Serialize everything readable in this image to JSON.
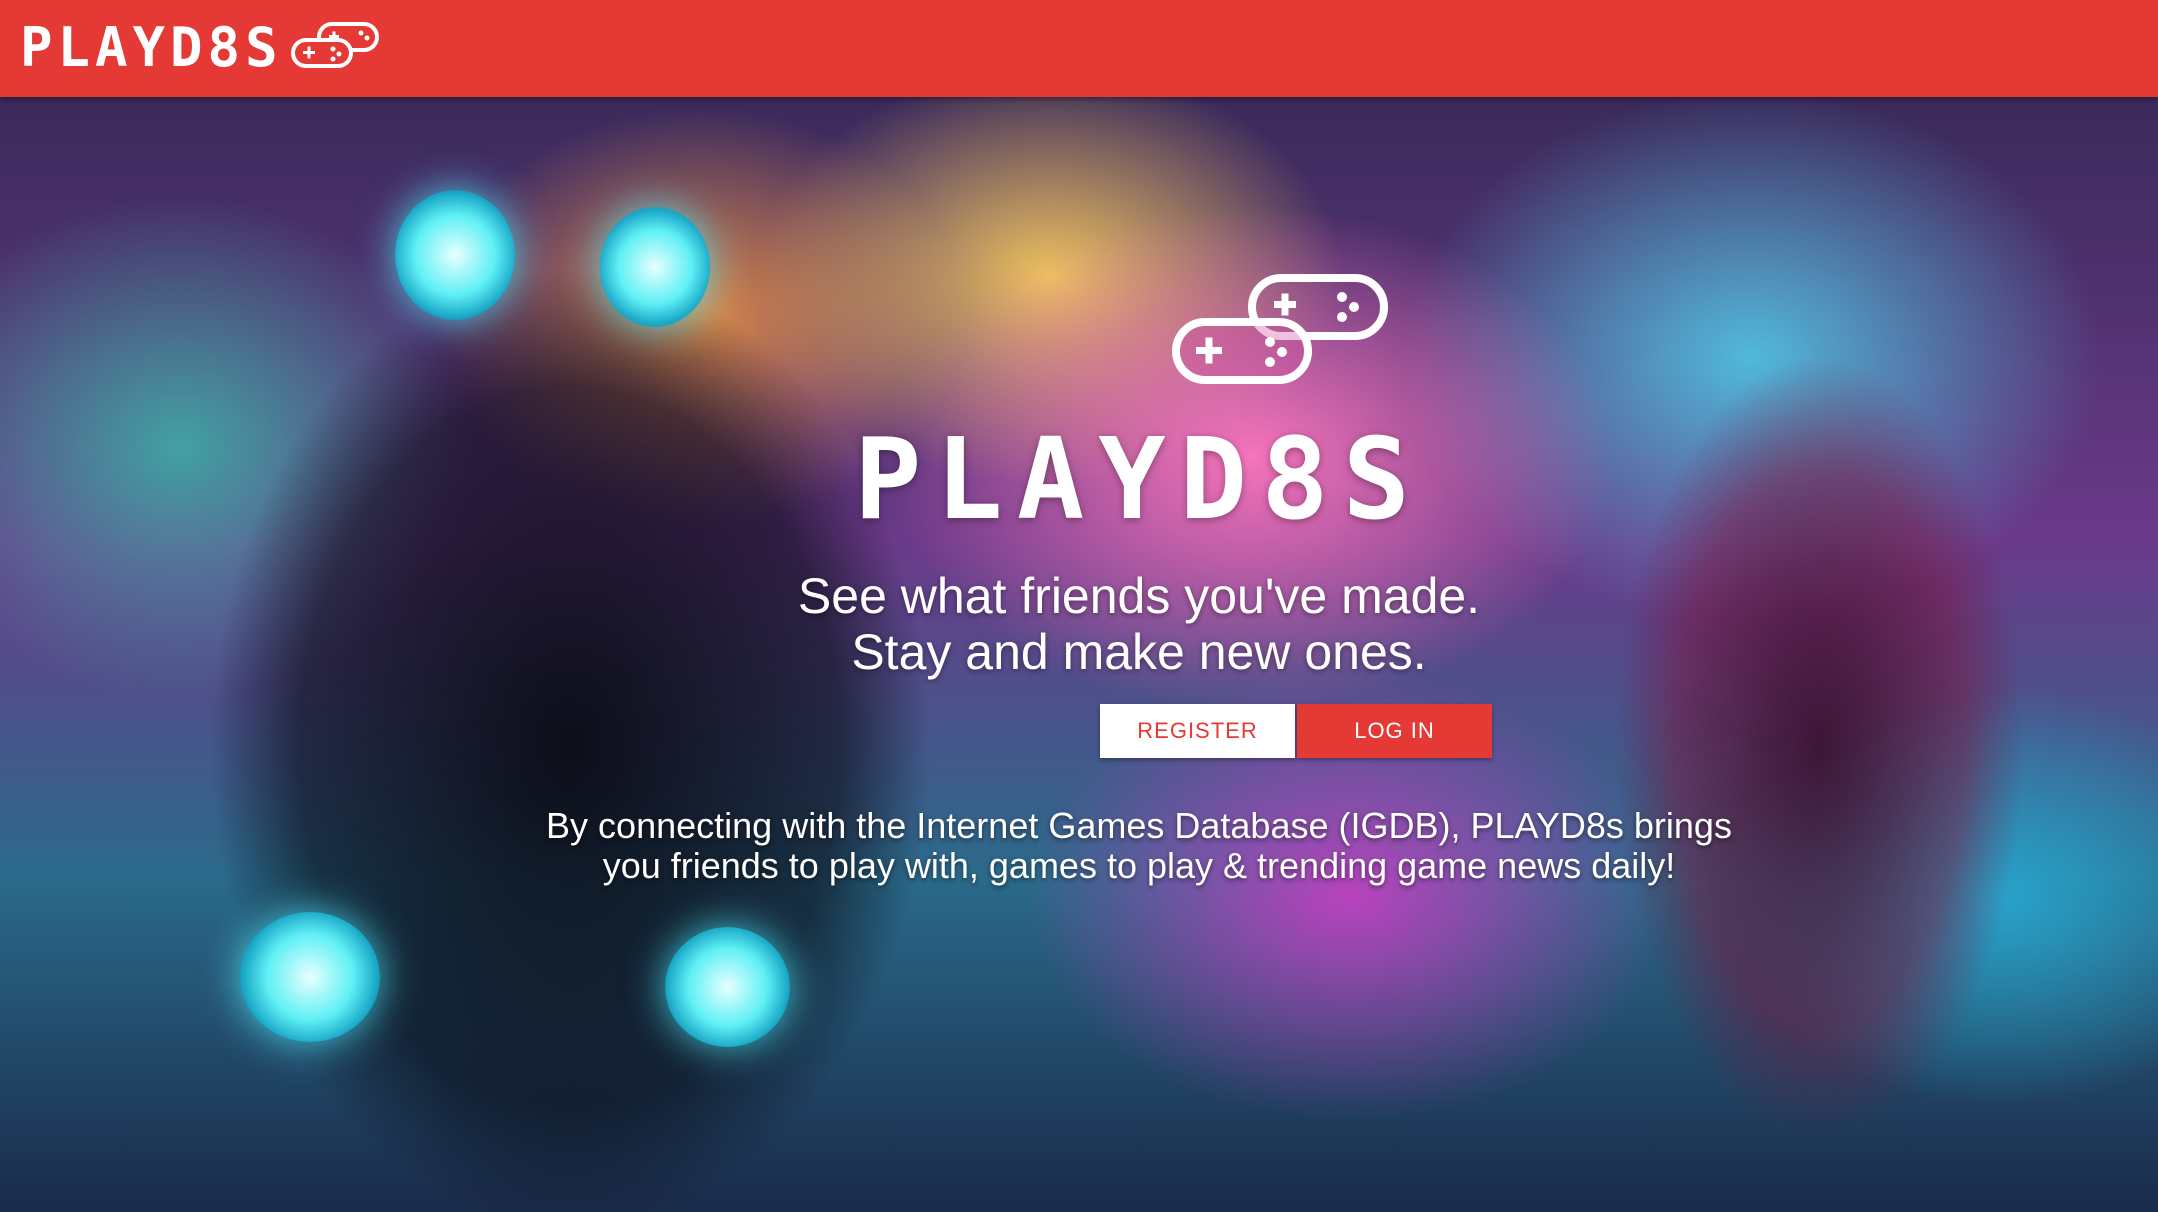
{
  "navbar": {
    "brand": "PLAYD8S",
    "brand_icon": "gamepad-icon",
    "background_color": "#e53935"
  },
  "hero": {
    "logo_icon": "gamepad-icon",
    "title": "PLAYD8S",
    "tagline_line1": "See what friends you've made.",
    "tagline_line2": "Stay and make new ones.",
    "register_label": "REGISTER",
    "login_label": "LOG IN",
    "description_line1": "By connecting with the Internet Games Database (IGDB), PLAYD8s brings",
    "description_line2": "you friends to play with, games to play & trending game news daily!"
  },
  "colors": {
    "accent": "#e53935",
    "text": "#ffffff"
  }
}
